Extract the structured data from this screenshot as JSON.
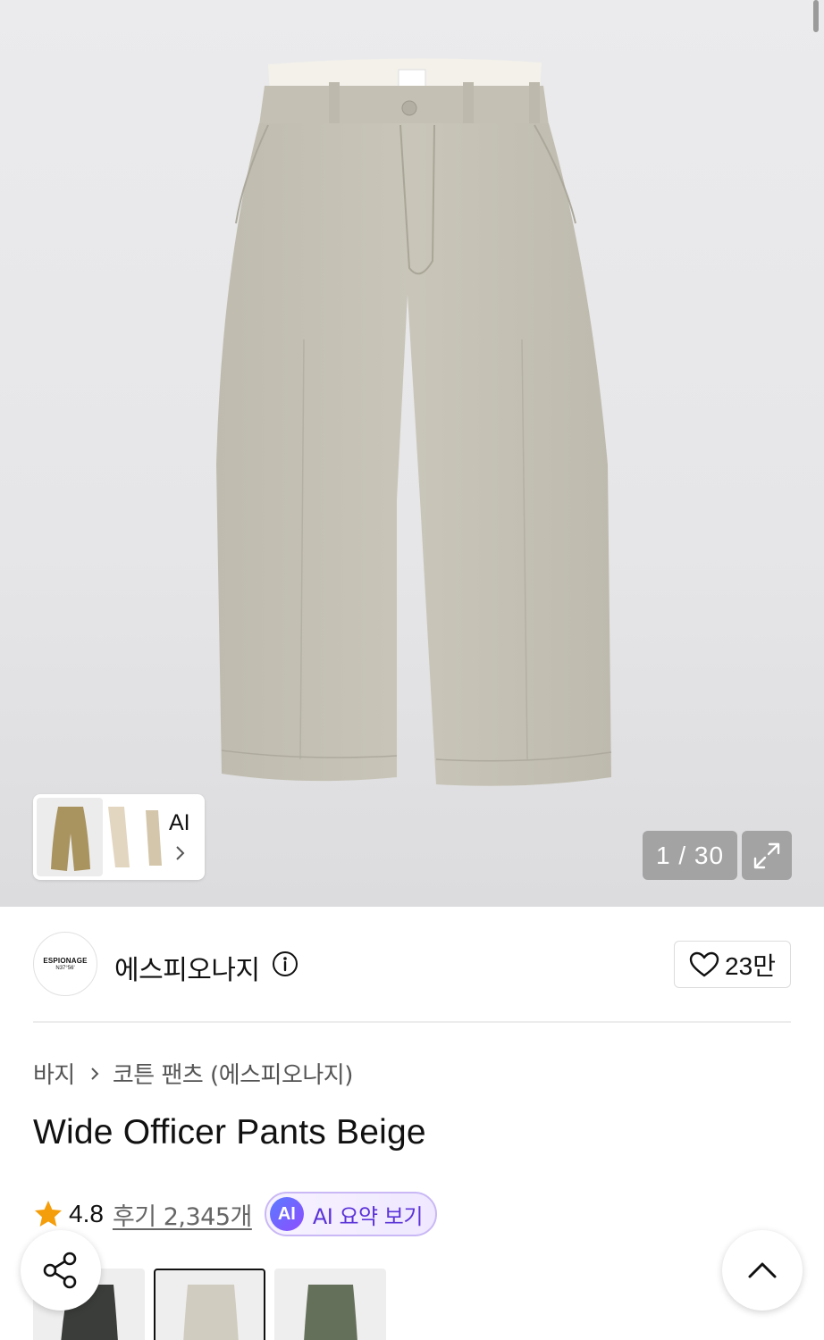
{
  "gallery": {
    "ai_thumbs_label": "AI",
    "page_counter": "1 / 30",
    "current_page": 1,
    "total_pages": 30
  },
  "brand": {
    "logo_text": "ESPIONAGE",
    "logo_subtext": "N37°56'",
    "name": "에스피오나지",
    "like_count": "23만"
  },
  "breadcrumb": {
    "items": [
      "바지",
      "코튼 팬츠 (에스피오나지)"
    ]
  },
  "product": {
    "title": "Wide Officer Pants Beige"
  },
  "rating": {
    "value": "4.8",
    "reviews_label": "후기 2,345개",
    "ai_badge": "AI",
    "ai_summary_label": "AI 요약 보기"
  },
  "colors": {
    "star": "#F59E0B",
    "ai_purple": "#5B33D8"
  },
  "icons": {
    "info": "info-icon",
    "heart": "heart-icon",
    "expand": "expand-icon",
    "share": "share-icon",
    "scroll_top": "chevron-up-icon"
  }
}
